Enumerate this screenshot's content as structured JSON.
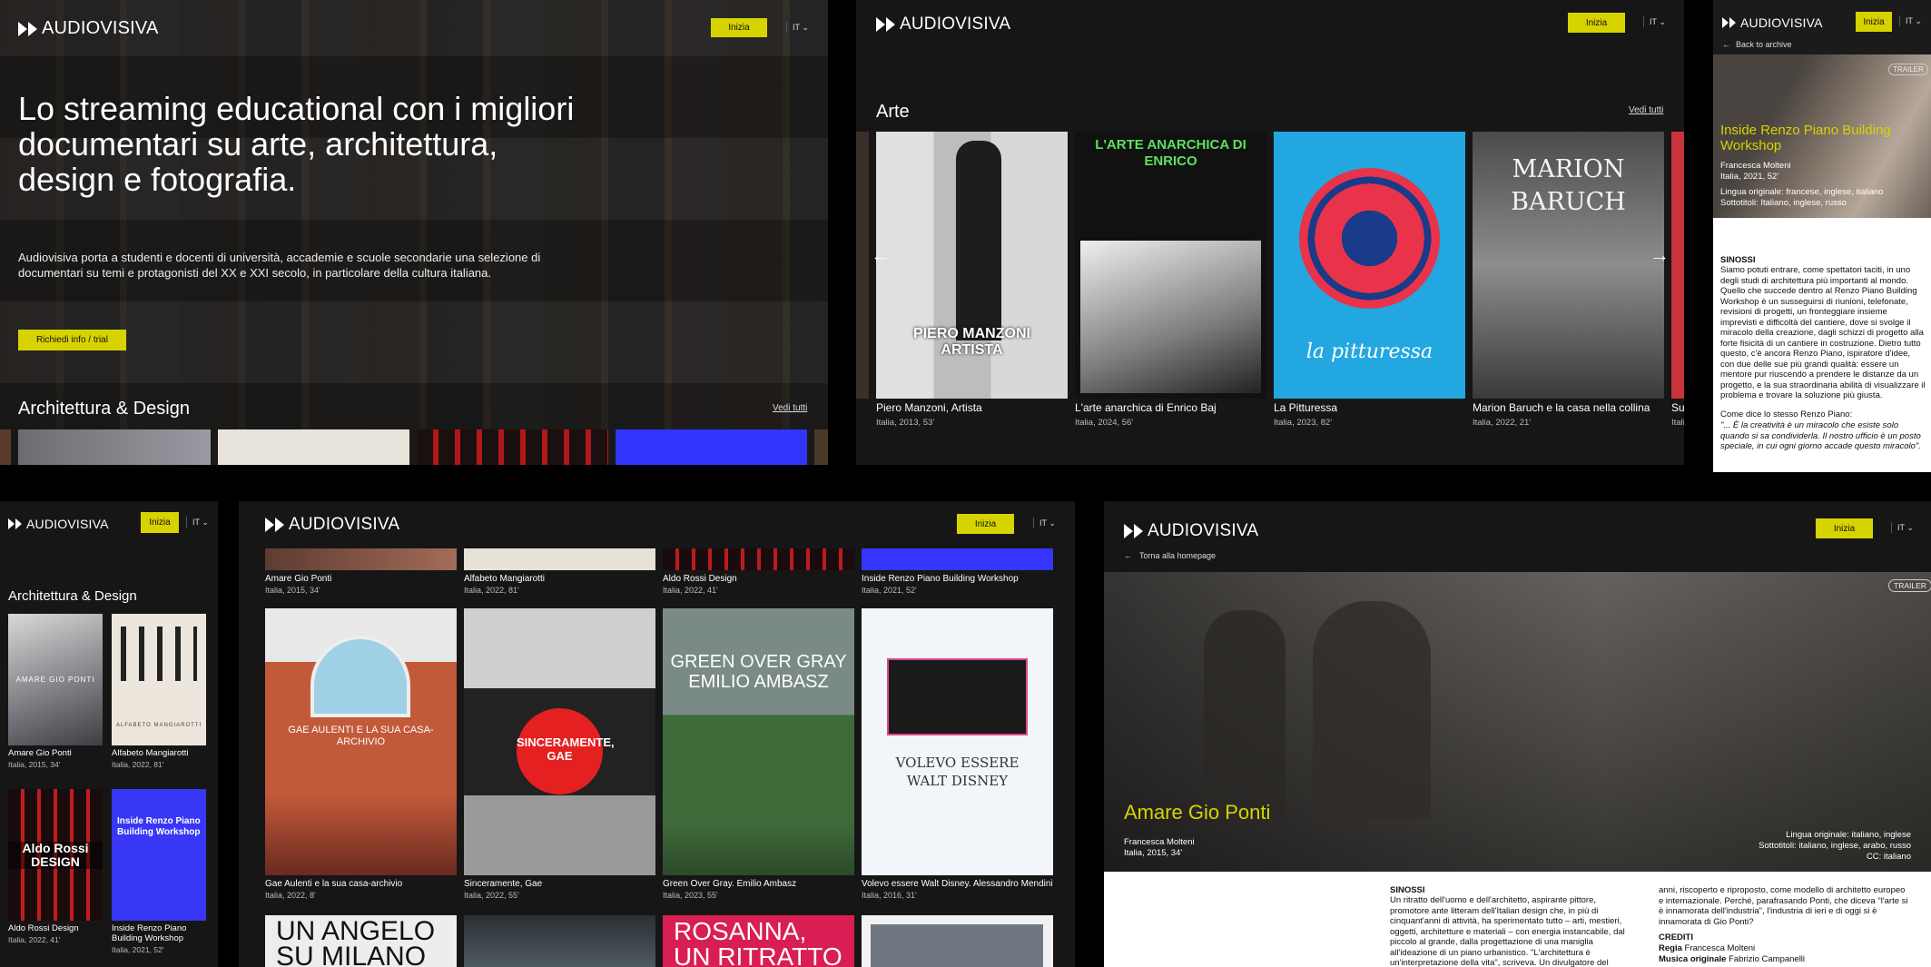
{
  "brand": "AUDIOVISIVA",
  "nav": {
    "start": "Inizia",
    "lang": "IT"
  },
  "colors": {
    "accent": "#d6d300",
    "dark": "#161616",
    "paper": "#ffffff"
  },
  "home": {
    "headline": "Lo streaming educational con i migliori documentari su arte, architettura, design e fotografia.",
    "description": "Audiovisiva porta a studenti e docenti di università, accademie e scuole secondarie una selezione di documentari su temi e protagonisti del XX e XXI secolo, in particolare della cultura italiana.",
    "cta": "Richiedi info / trial",
    "section": "Architettura & Design",
    "see_all": "Vedi tutti"
  },
  "arte": {
    "section": "Arte",
    "see_all": "Vedi tutti",
    "items": [
      {
        "title": "Piero Manzoni, Artista",
        "meta": "Italia, 2013, 53'",
        "poster_text": "PIERO MANZONI ARTISTA"
      },
      {
        "title": "L'arte anarchica di Enrico Baj",
        "meta": "Italia, 2024, 56'",
        "poster_text": "L'ARTE ANARCHICA DI ENRICO"
      },
      {
        "title": "La Pitturessa",
        "meta": "Italia, 2023, 82'",
        "poster_text": "la pitturessa"
      },
      {
        "title": "Marion Baruch e la casa nella collina",
        "meta": "Italia, 2022, 21'",
        "poster_text": "MARION BARUCH"
      },
      {
        "title": "Sul",
        "meta": "Itali"
      }
    ]
  },
  "detail_small": {
    "back": "Back to archive",
    "trailer": "TRAILER",
    "title": "Inside Renzo Piano Building Workshop",
    "director": "Francesca Molteni",
    "meta": "Italia, 2021, 52'",
    "lang_orig": "Lingua originale: francese, inglese, italiano",
    "subs": "Sottotitoli: Italiano, inglese, russo",
    "synopsis_label": "SINOSSI",
    "synopsis": "Siamo potuti entrare, come spettatori taciti, in uno degli studi di architettura più importanti al mondo. Quello che succede dentro al Renzo Piano Building Workshop è un susseguirsi di riunioni, telefonate, revisioni di progetti, un fronteggiare insieme imprevisti e difficoltà del cantiere, dove si svolge il miracolo della creazione, dagli schizzi di progetto alla forte fisicità di un cantiere in costruzione. Dietro tutto questo, c'è ancora Renzo Piano, ispiratore d'idee, con due delle sue più grandi qualità: essere un mentore pur riuscendo a prendere le distanze da un progetto, e la sua straordinaria abilità di visualizzare il problema e trovare la soluzione più giusta.",
    "quote_intro": "Come dice lo stesso Renzo Piano:",
    "quote": "\"... È la creatività è un miracolo che esiste solo quando si sa condividerla. Il nostro ufficio è un posto speciale, in cui ogni giorno accade questo miracolo\"."
  },
  "mobile_list": {
    "section": "Architettura & Design",
    "items": [
      {
        "title": "Amare Gio Ponti",
        "meta": "Italia, 2015, 34'",
        "poster_text": "AMARE GIO PONTI"
      },
      {
        "title": "Alfabeto Mangiarotti",
        "meta": "Italia, 2022, 81'",
        "poster_text": "ALFABETO MANGIAROTTI"
      },
      {
        "title": "Aldo Rossi Design",
        "meta": "Italia, 2022, 41'",
        "poster_text": "Aldo Rossi DESIGN"
      },
      {
        "title": "Inside Renzo Piano Building Workshop",
        "meta": "Italia, 2021, 52'",
        "poster_text": "Inside Renzo Piano Building Workshop"
      }
    ]
  },
  "grid": {
    "top": [
      {
        "title": "Amare Gio Ponti",
        "meta": "Italia, 2015, 34'"
      },
      {
        "title": "Alfabeto Mangiarotti",
        "meta": "Italia, 2022, 81'"
      },
      {
        "title": "Aldo Rossi Design",
        "meta": "Italia, 2022, 41'"
      },
      {
        "title": "Inside Renzo Piano Building Workshop",
        "meta": "Italia, 2021, 52'"
      }
    ],
    "mid": [
      {
        "title": "Gae Aulenti e la sua casa-archivio",
        "meta": "Italia, 2022, 8'",
        "poster_text": "GAE AULENTI E LA SUA CASA-ARCHIVIO"
      },
      {
        "title": "Sinceramente, Gae",
        "meta": "Italia, 2022, 55'",
        "poster_text": "SINCERAMENTE, GAE"
      },
      {
        "title": "Green Over Gray. Emilio Ambasz",
        "meta": "Italia, 2023, 55'",
        "poster_text": "GREEN OVER GRAY EMILIO AMBASZ"
      },
      {
        "title": "Volevo essere Walt Disney. Alessandro Mendini",
        "meta": "Italia, 2016, 31'",
        "poster_text": "VOLEVO ESSERE WALT DISNEY"
      }
    ],
    "bottom": [
      {
        "poster_text": "UN ANGELO SU MILANO"
      },
      {
        "poster_text": ""
      },
      {
        "poster_text": "ROSANNA, UN RITRATTO"
      },
      {
        "poster_text": ""
      }
    ]
  },
  "detail_large": {
    "back": "Torna alla homepage",
    "trailer": "TRAILER",
    "title": "Amare Gio Ponti",
    "director": "Francesca Molteni",
    "meta": "Italia, 2015, 34'",
    "lang_orig": "Lingua originale: italiano, inglese",
    "subs": "Sottotitoli: italiano, inglese, arabo, russo",
    "cc": "CC: italiano",
    "synopsis_label": "SINOSSI",
    "synopsis": "Un ritratto dell'uomo e dell'architetto, aspirante pittore, promotore ante litteram dell'Italian design che, in più di cinquant'anni di attività, ha sperimentato tutto – arti, mestieri, oggetti, architetture e materiali – con energia instancabile, dal piccolo al grande, dalla progettazione di una maniglia all'ideazione di un piano urbanistico. \"L'architettura è un'interpretazione della vita\", scriveva. Un divulgatore del",
    "synopsis2": "anni, riscoperto e riproposto, come modello di architetto europeo e internazionale. Perché, parafrasando Ponti, che diceva \"l'arte si è innamorata dell'industria\", l'industria di ieri e di oggi si è innamorata di Gio Ponti?",
    "credits_label": "CREDITI",
    "regia_label": "Regia",
    "regia": "Francesca Molteni",
    "musica_label": "Musica originale",
    "musica": "Fabrizio Campanelli"
  }
}
